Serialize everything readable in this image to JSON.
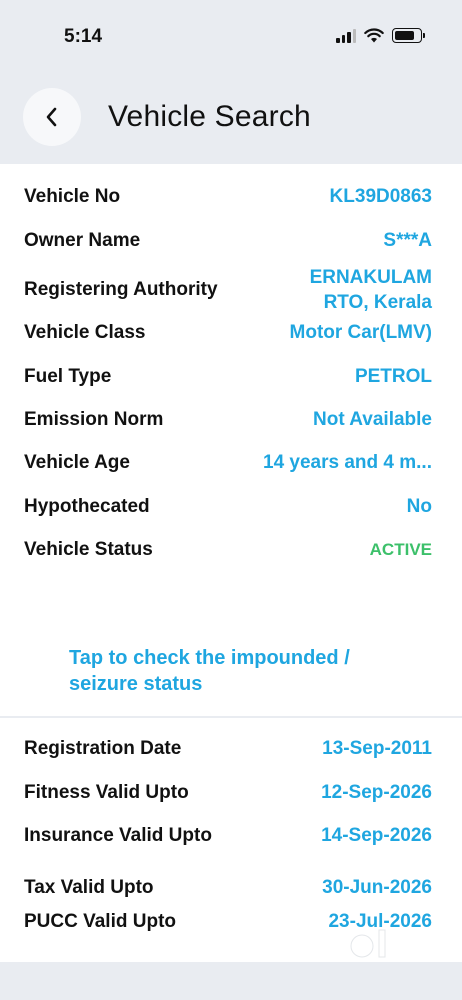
{
  "status": {
    "time": "5:14"
  },
  "header": {
    "title": "Vehicle Search"
  },
  "details": [
    {
      "label": "Vehicle No",
      "value": "KL39D0863"
    },
    {
      "label": "Owner Name",
      "value": "S***A"
    },
    {
      "label": "Registering Authority",
      "value": "ERNAKULAM RTO, Kerala"
    },
    {
      "label": "Vehicle Class",
      "value": "Motor Car(LMV)"
    },
    {
      "label": "Fuel Type",
      "value": "PETROL"
    },
    {
      "label": "Emission Norm",
      "value": "Not Available"
    },
    {
      "label": "Vehicle Age",
      "value": "14 years and 4 m..."
    },
    {
      "label": "Hypothecated",
      "value": "No"
    },
    {
      "label": "Vehicle Status",
      "value": "ACTIVE"
    }
  ],
  "impound_link": "Tap to check the impounded / seizure status",
  "validity": [
    {
      "label": "Registration Date",
      "value": "13-Sep-2011"
    },
    {
      "label": "Fitness Valid Upto",
      "value": "12-Sep-2026"
    },
    {
      "label": "Insurance Valid Upto",
      "value": "14-Sep-2026"
    },
    {
      "label": "Tax Valid Upto",
      "value": "30-Jun-2026"
    },
    {
      "label": "PUCC Valid Upto",
      "value": "23-Jul-2026"
    }
  ],
  "colors": {
    "accent": "#1fa6e0",
    "active": "#3cc06a",
    "background": "#e9ecf1"
  },
  "icons": {
    "back": "chevron-left-icon",
    "signal": "cellular-signal-icon",
    "wifi": "wifi-icon",
    "battery": "battery-icon",
    "watermark": "olx-watermark"
  }
}
